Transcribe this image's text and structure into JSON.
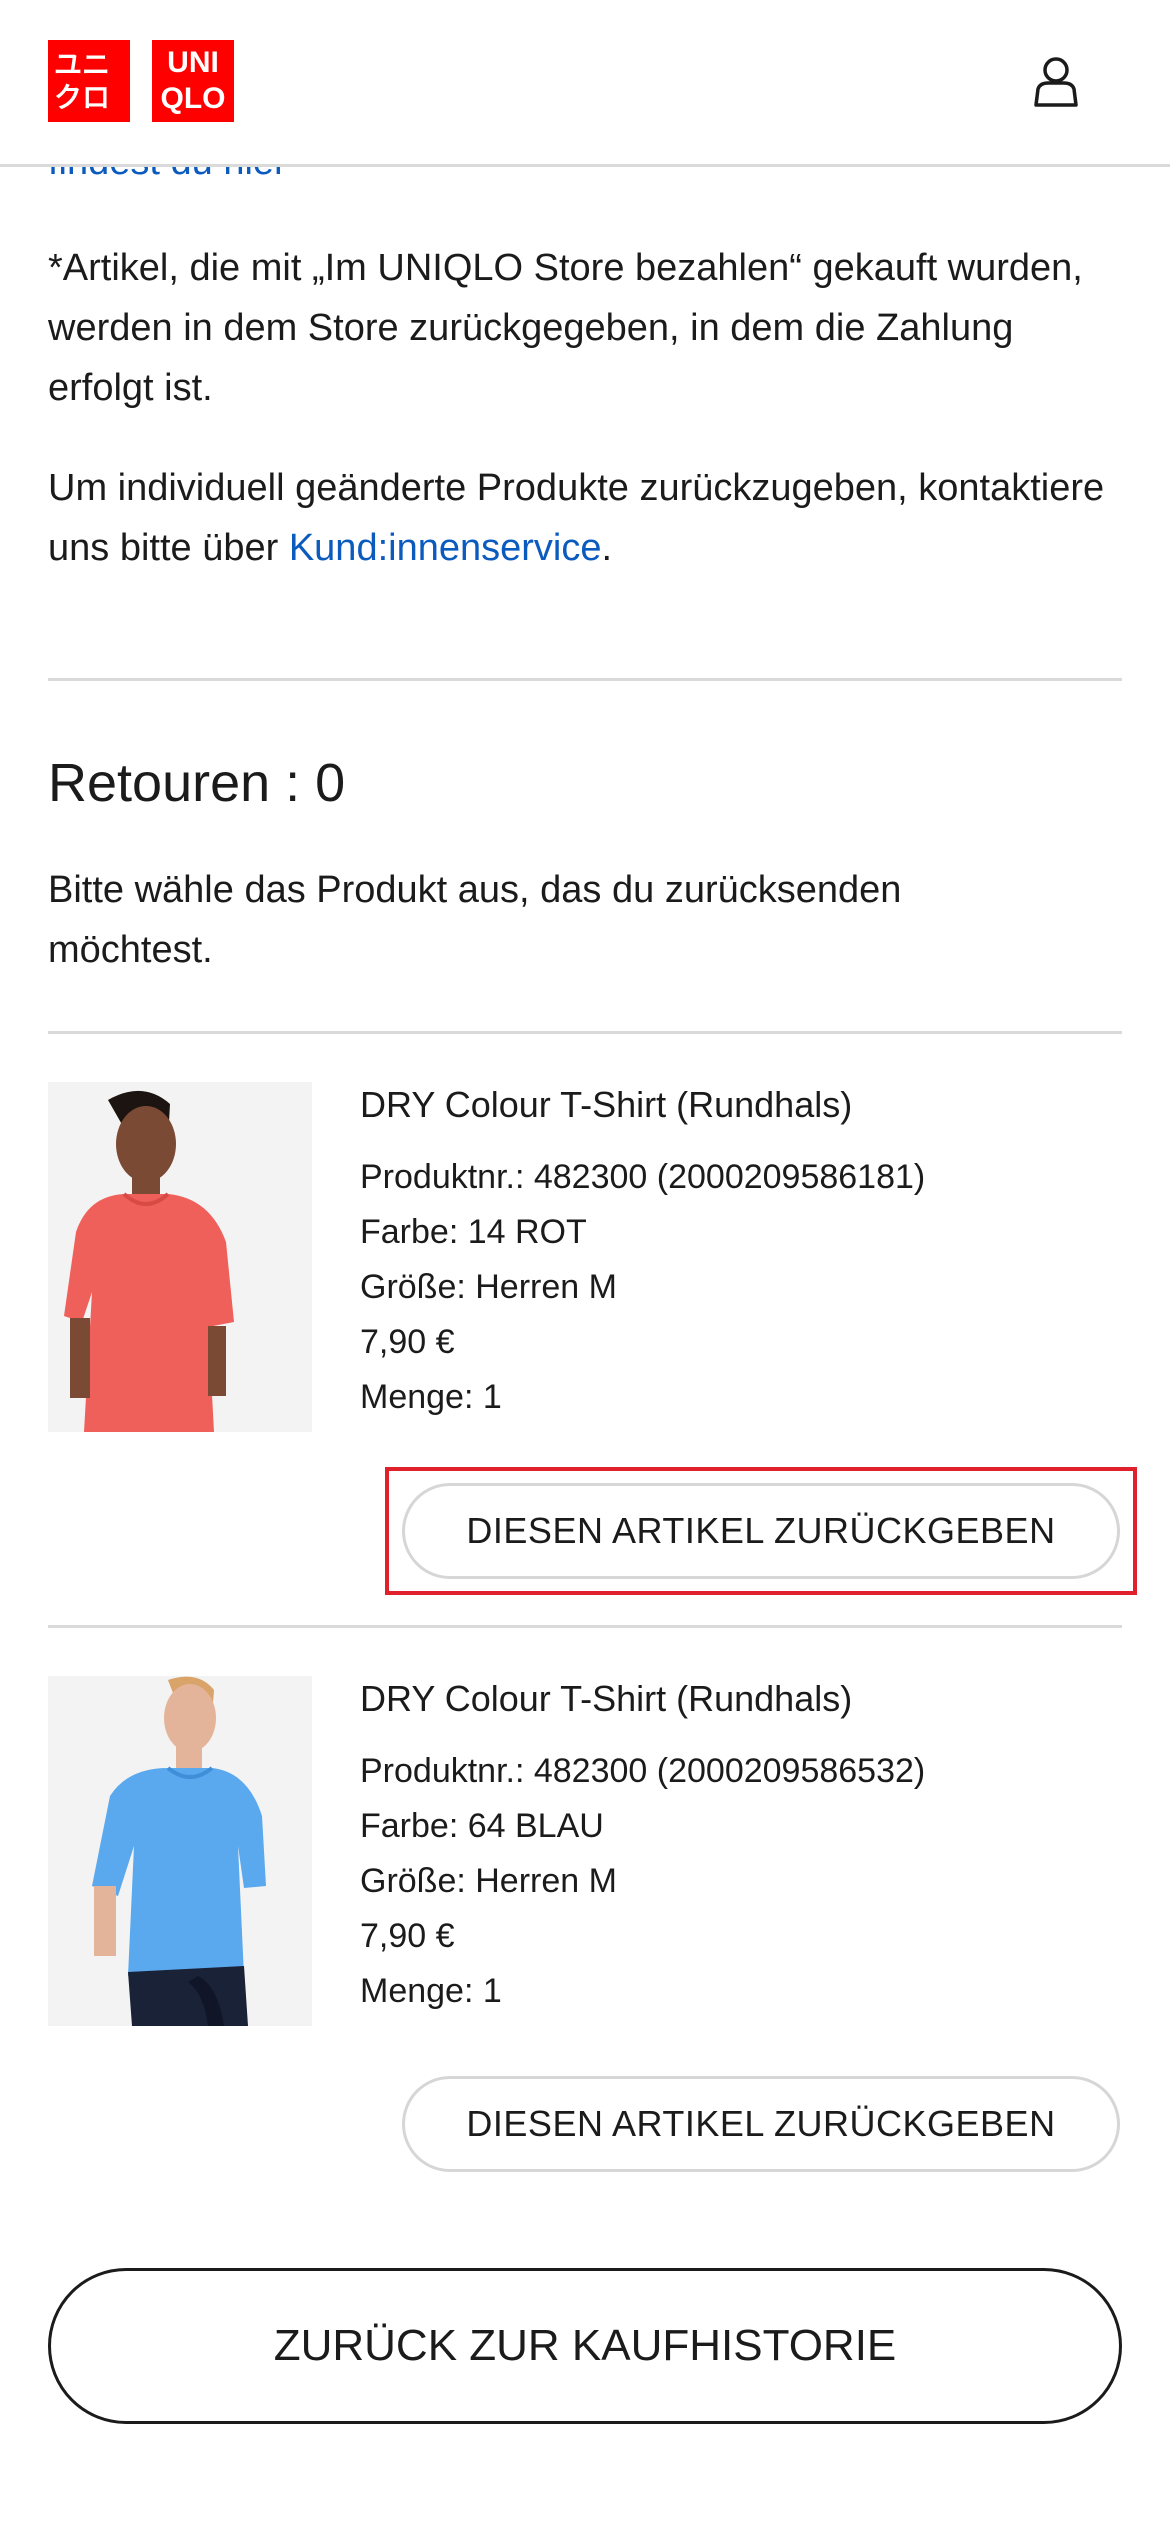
{
  "header": {
    "logo_top_left": [
      "ユ",
      "ニ",
      "ク",
      "ロ"
    ],
    "logo_right": [
      "UNI",
      "QLO"
    ],
    "account_icon": "user-icon"
  },
  "notes": {
    "partial_link": "findest du hier",
    "store_payment_note": "*Artikel, die mit „Im UNIQLO Store bezahlen“ gekauft wurden, werden in dem Store zurückgegeben, in dem die Zahlung erfolgt ist.",
    "custom_products_text": "Um individuell geänderte Produkte zurückzugeben, kontaktiere uns bitte über ",
    "customer_service_link": "Kund:innenservice",
    "custom_products_end": "."
  },
  "returns": {
    "title": "Retouren : 0",
    "instruction": "Bitte wähle das Produkt aus, das du zurücksenden möchtest."
  },
  "products": [
    {
      "name": "DRY Colour T-Shirt (Rundhals)",
      "product_no": "Produktnr.: 482300 (2000209586181)",
      "color": "Farbe: 14 ROT",
      "size": "Größe: Herren M",
      "price": "7,90 €",
      "quantity": "Menge: 1",
      "return_button": "DIESEN ARTIKEL ZURÜCKGEBEN",
      "shirt_color": "#f0605a",
      "skin_color": "#7a4a34"
    },
    {
      "name": "DRY Colour T-Shirt (Rundhals)",
      "product_no": "Produktnr.: 482300 (2000209586532)",
      "color": "Farbe: 64 BLAU",
      "size": "Größe: Herren M",
      "price": "7,90 €",
      "quantity": "Menge: 1",
      "return_button": "DIESEN ARTIKEL ZURÜCKGEBEN",
      "shirt_color": "#5aa8ee",
      "skin_color": "#e4b49a"
    }
  ],
  "back_button": "ZURÜCK ZUR KAUFHISTORIE",
  "colors": {
    "brand_red": "#ff0000",
    "link_blue": "#0b5bbe",
    "highlight_red": "#e0202a"
  }
}
